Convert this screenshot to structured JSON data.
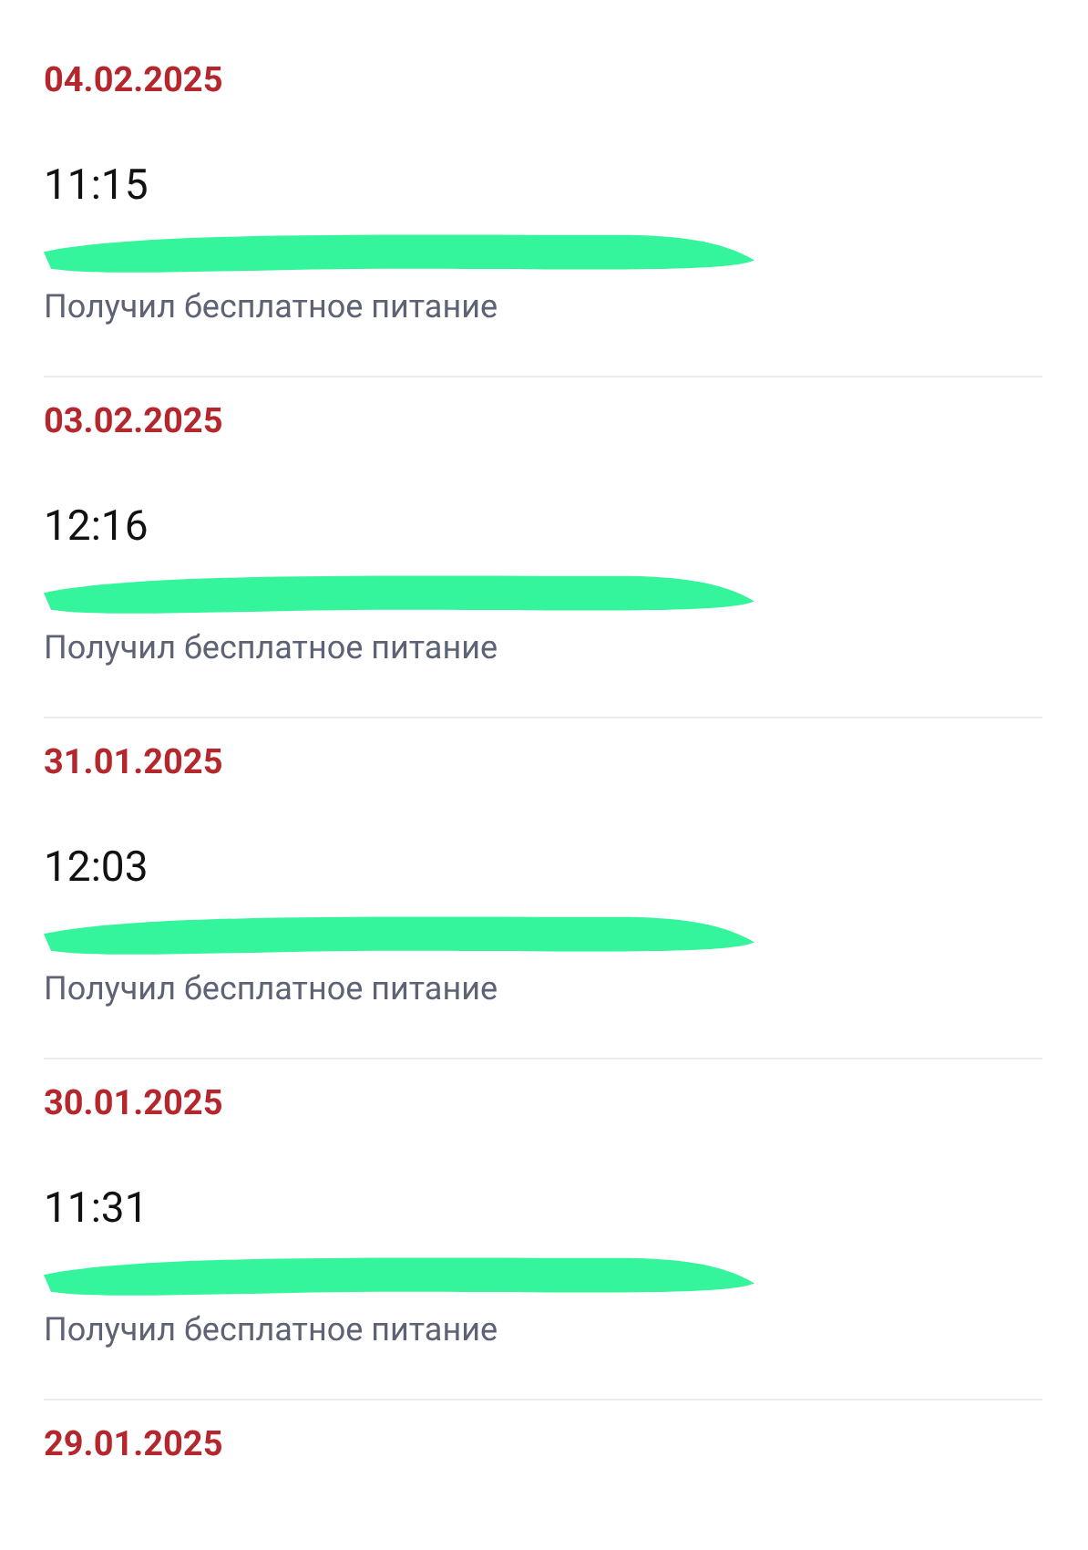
{
  "days": [
    {
      "date": "04.02.2025",
      "entries": [
        {
          "time": "11:15",
          "description": "Получил бесплатное питание"
        }
      ]
    },
    {
      "date": "03.02.2025",
      "entries": [
        {
          "time": "12:16",
          "description": "Получил бесплатное питание"
        }
      ]
    },
    {
      "date": "31.01.2025",
      "entries": [
        {
          "time": "12:03",
          "description": "Получил бесплатное питание"
        }
      ]
    },
    {
      "date": "30.01.2025",
      "entries": [
        {
          "time": "11:31",
          "description": "Получил бесплатное питание"
        }
      ]
    },
    {
      "date": "29.01.2025"
    }
  ]
}
